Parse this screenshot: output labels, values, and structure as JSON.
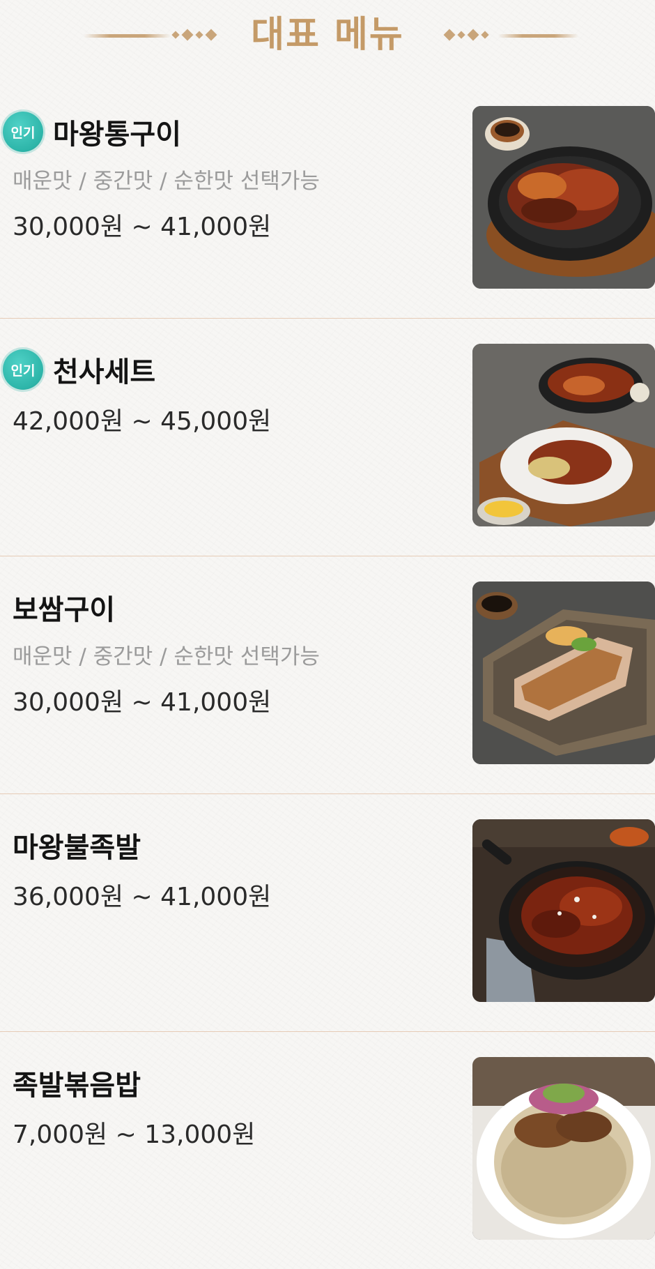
{
  "header": {
    "title": "대표 메뉴"
  },
  "menu": {
    "items": [
      {
        "name": "마왕통구이",
        "badge": "인기",
        "option": "매운맛 / 중간맛 / 순한맛 선택가능",
        "price": "30,000원 ~ 41,000원",
        "image": "roasted-pork-skillet-image"
      },
      {
        "name": "천사세트",
        "badge": "인기",
        "option": "",
        "price": "42,000원 ~ 45,000원",
        "image": "set-platter-image"
      },
      {
        "name": "보쌈구이",
        "badge": "",
        "option": "매운맛 / 중간맛 / 순한맛 선택가능",
        "price": "30,000원 ~ 41,000원",
        "image": "grilled-bossam-tray-image"
      },
      {
        "name": "마왕불족발",
        "badge": "",
        "option": "",
        "price": "36,000원 ~ 41,000원",
        "image": "spicy-jokbal-skillet-image"
      },
      {
        "name": "족발볶음밥",
        "badge": "",
        "option": "",
        "price": "7,000원 ~ 13,000원",
        "image": "jokbal-fried-rice-image"
      }
    ]
  },
  "colors": {
    "accent_gold": "#c49a67",
    "badge_teal": "#2db5a9",
    "divider": "#e6cbb6",
    "option_gray": "#9b9b9b"
  }
}
